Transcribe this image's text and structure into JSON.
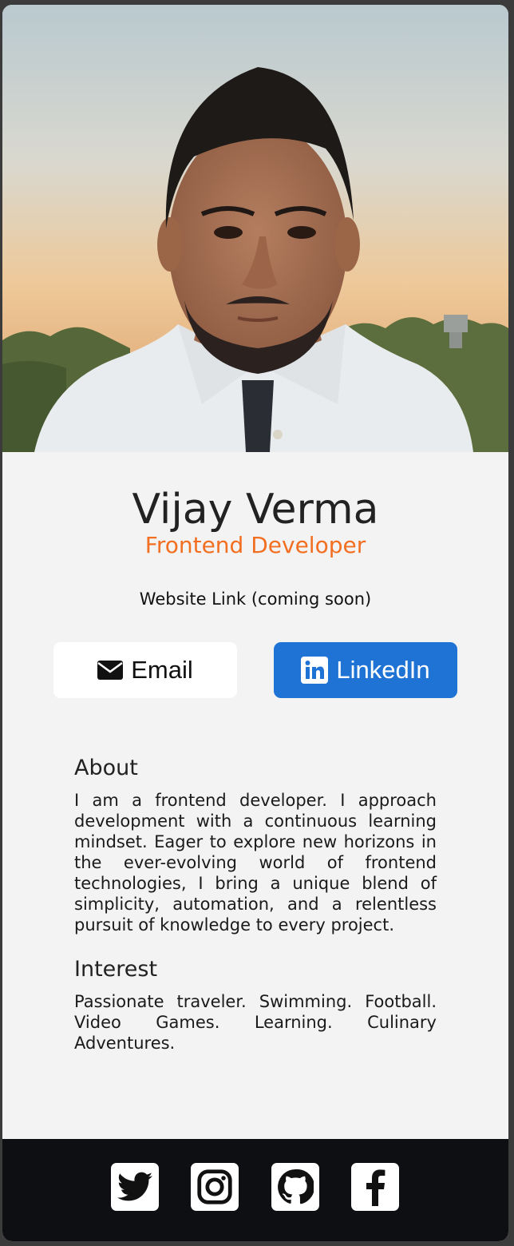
{
  "profile": {
    "photo_alt": "Portrait of Vijay Verma",
    "name": "Vijay Verma",
    "title": "Frontend Developer",
    "website": "Website Link (coming soon)"
  },
  "buttons": {
    "email_label": "Email",
    "email_icon": "envelope-icon",
    "linkedin_label": "LinkedIn",
    "linkedin_icon": "linkedin-icon"
  },
  "about": {
    "heading": "About",
    "text": "I am a frontend developer. I approach development with a continuous learning mindset. Eager to explore new horizons in the ever-evolving world of frontend technologies, I bring a unique blend of simplicity, automation, and a relentless pursuit of knowledge to every project."
  },
  "interest": {
    "heading": "Interest",
    "text": "Passionate traveler. Swimming. Football. Video Games. Learning. Culinary Adventures."
  },
  "footer": {
    "icons": [
      "twitter-icon",
      "instagram-icon",
      "github-icon",
      "facebook-icon"
    ]
  },
  "colors": {
    "accent": "#f26f21",
    "linkedin": "#1f73d4",
    "background": "#3b3b3c",
    "card": "#f3f3f3",
    "footer": "#0d0f13"
  }
}
